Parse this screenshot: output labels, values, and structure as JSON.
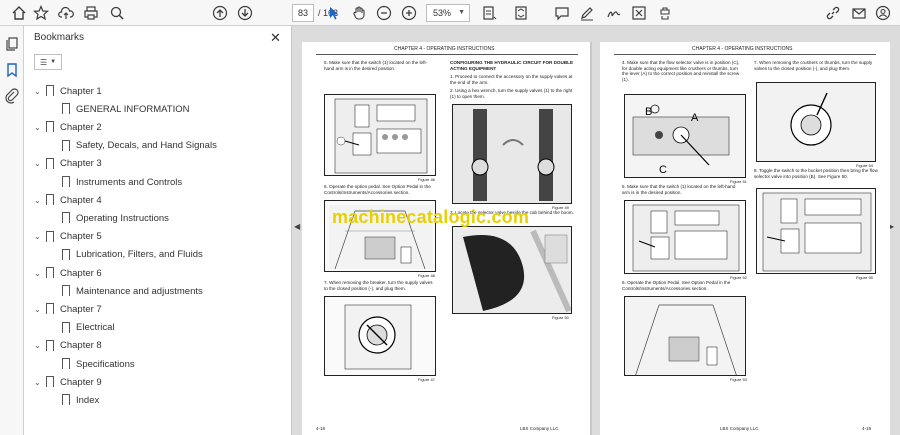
{
  "toolbar": {
    "page_current": "83",
    "page_total": "/ 162",
    "zoom": "53%"
  },
  "bookmarks": {
    "title": "Bookmarks",
    "items": [
      {
        "label": "Chapter 1",
        "level": 0
      },
      {
        "label": "GENERAL INFORMATION",
        "level": 1
      },
      {
        "label": "Chapter 2",
        "level": 0
      },
      {
        "label": "Safety, Decals, and Hand Signals",
        "level": 1
      },
      {
        "label": "Chapter 3",
        "level": 0
      },
      {
        "label": "Instruments and Controls",
        "level": 1
      },
      {
        "label": "Chapter 4",
        "level": 0
      },
      {
        "label": "Operating Instructions",
        "level": 1
      },
      {
        "label": "Chapter 5",
        "level": 0
      },
      {
        "label": "Lubrication, Filters, and Fluids",
        "level": 1
      },
      {
        "label": "Chapter 6",
        "level": 0
      },
      {
        "label": "Maintenance and adjustments",
        "level": 1
      },
      {
        "label": "Chapter 7",
        "level": 0
      },
      {
        "label": "Electrical",
        "level": 1
      },
      {
        "label": "Chapter 8",
        "level": 0
      },
      {
        "label": "Specifications",
        "level": 1
      },
      {
        "label": "Chapter 9",
        "level": 0
      },
      {
        "label": "Index",
        "level": 1
      }
    ]
  },
  "document": {
    "watermark": "machinecatalogic.com",
    "left_page": {
      "header": "CHAPTER 4 - OPERATING INSTRUCTIONS",
      "col1_step5": "5. Make sure that the switch (1) located on the left-hand arm is in the desired position.",
      "col1_step6": "6. Operate the option pedal. See Option Pedal in the Controls/Instruments/Accessories section.",
      "col1_step7": "7. When removing the breaker, turn the supply valves to the closed position (-), and plug them.",
      "col2_heading": "CONFIGURING THE HYDRAULIC CIRCUIT FOR DOUBLE ACTING EQUIPMENT",
      "col2_step1": "1. Proceed to connect the accessory on the supply valves at the end of the arm.",
      "col2_step2": "2. Using a hex wrench, turn the supply valves (1) to the right (1) to open them.",
      "col2_step3": "3. Locate the selector valve beside the cab behind the boom.",
      "fig_a": "Figure 46",
      "fig_b": "Figure 48",
      "fig_c": "Figure 47",
      "fig_d": "Figure 49",
      "fig_e": "Figure 50",
      "footer_left": "4-18",
      "footer_right": "LBX Company LLC"
    },
    "right_page": {
      "header": "CHAPTER 4 - OPERATING INSTRUCTIONS",
      "col1_step4": "4. Make sure that the flow selector valve is in position (C), for double acting equipment like crushers or thumbs, turn the lever (A) to the correct position and reinstall the screw (1).",
      "col1_step5": "5. Make sure that the switch (1) located on the left-hand arm is in the desired position.",
      "col1_step6": "6. Operate the Option Pedal. See Option Pedal in the Controls/Instruments/Accessories section.",
      "col2_step7": "7. When removing the crushers or thumbs, turn the supply valves to the closed position (-), and plug them.",
      "col2_step8": "8. Toggle the switch to the bucket position then bring the flow selector valve into position (B). See Figure 50.",
      "label_b": "B",
      "label_a": "A",
      "label_c": "C",
      "fig_a": "Figure 51",
      "fig_b": "Figure 52",
      "fig_c": "Figure 53",
      "fig_d": "Figure 54",
      "fig_e": "Figure 55",
      "footer_left": "LBX Company LLC",
      "footer_right": "4-19"
    }
  }
}
